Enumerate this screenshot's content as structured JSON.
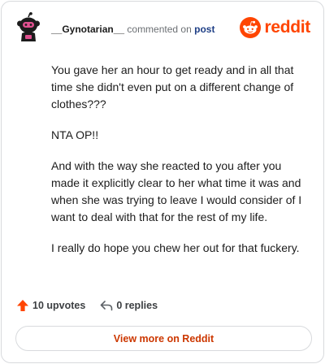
{
  "comment": {
    "username": "__Gynotarian__",
    "commented_text": "commented on",
    "post_link": "post",
    "paragraphs": [
      "You gave her an hour to get ready and in all that time she didn't even put on a different change of clothes???",
      "NTA OP!!",
      "And with the way she reacted to you after you made it explicitly clear to her what time it was and when she was trying to leave I would consider of I want to deal with that for the rest of my life.",
      "I really do hope you chew her out for that fuckery."
    ]
  },
  "brand": {
    "name": "reddit",
    "icon": "reddit-logo-icon",
    "color": "#ff4500"
  },
  "stats": {
    "upvotes": "10 upvotes",
    "replies": "0 replies",
    "upvote_icon": "upvote-arrow-icon",
    "reply_icon": "reply-arrow-icon"
  },
  "actions": {
    "view_more": "View more on Reddit"
  }
}
